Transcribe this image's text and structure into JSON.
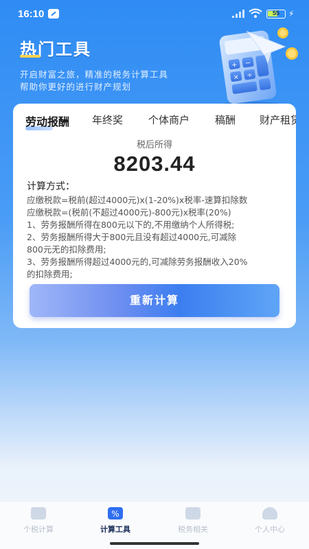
{
  "status_bar": {
    "time": "16:10",
    "battery": "55"
  },
  "header": {
    "title": "热门工具",
    "subtitle_line1": "开启财富之旅，精准的税务计算工具",
    "subtitle_line2": "帮助你更好的进行财产规划"
  },
  "tabs": [
    {
      "label": "劳动报酬",
      "active": true
    },
    {
      "label": "年终奖",
      "active": false
    },
    {
      "label": "个体商户",
      "active": false
    },
    {
      "label": "稿酬",
      "active": false
    },
    {
      "label": "财产租赁",
      "active": false
    }
  ],
  "result": {
    "label": "税后所得",
    "value": "8203.44"
  },
  "method": {
    "title": "计算方式：",
    "lines": [
      "应缴税款=税前(超过4000元)x(1-20%)x税率-速算扣除数",
      "应缴税款=(税前(不超过4000元)-800元)x税率(20%)",
      "1、劳务报酬所得在800元以下的,不用缴纳个人所得税;",
      "2、劳务报酬所得大于800元且没有超过4000元,可减除",
      "800元无的扣除费用;",
      "3、劳务报酬所得超过4000元的,可减除劳务报酬收入20%",
      "的扣除费用;"
    ]
  },
  "recalc_button": "重新计算",
  "nav": [
    {
      "label": "个税计算",
      "icon": "tax-calc-icon",
      "active": false
    },
    {
      "label": "计算工具",
      "icon": "calculator-icon",
      "active": true
    },
    {
      "label": "税务相关",
      "icon": "chart-icon",
      "active": false
    },
    {
      "label": "个人中心",
      "icon": "person-icon",
      "active": false
    }
  ],
  "colors": {
    "primary": "#2f8cf4",
    "accent": "#2f6ef0",
    "battery": "#c8f25a"
  }
}
